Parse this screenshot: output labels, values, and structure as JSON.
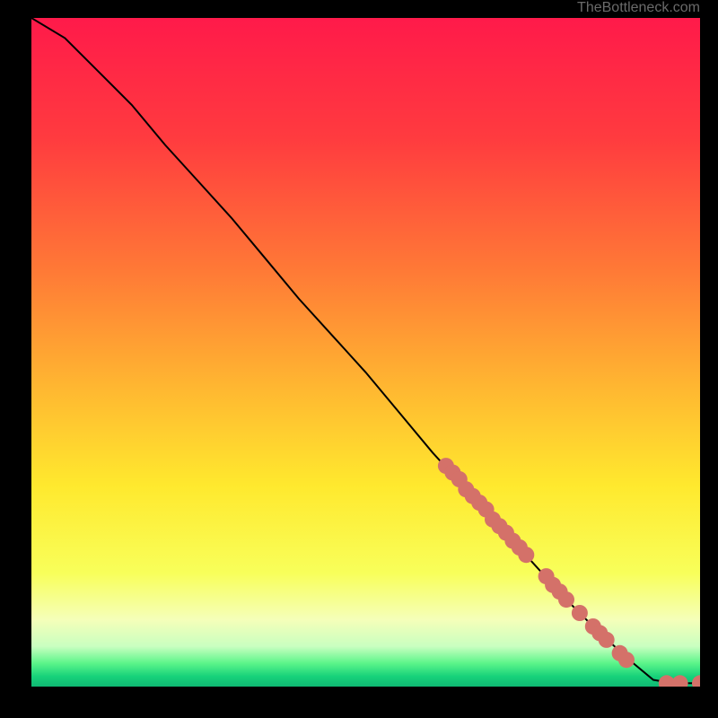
{
  "attribution": "TheBottleneck.com",
  "chart_data": {
    "type": "line",
    "title": "",
    "xlabel": "",
    "ylabel": "",
    "xlim": [
      0,
      100
    ],
    "ylim": [
      0,
      100
    ],
    "curve": [
      {
        "x": 0,
        "y": 100
      },
      {
        "x": 5,
        "y": 97
      },
      {
        "x": 10,
        "y": 92
      },
      {
        "x": 15,
        "y": 87
      },
      {
        "x": 20,
        "y": 81
      },
      {
        "x": 25,
        "y": 75.5
      },
      {
        "x": 30,
        "y": 70
      },
      {
        "x": 35,
        "y": 64
      },
      {
        "x": 40,
        "y": 58
      },
      {
        "x": 45,
        "y": 52.5
      },
      {
        "x": 50,
        "y": 47
      },
      {
        "x": 55,
        "y": 41
      },
      {
        "x": 60,
        "y": 35
      },
      {
        "x": 65,
        "y": 29.5
      },
      {
        "x": 70,
        "y": 24
      },
      {
        "x": 75,
        "y": 18.5
      },
      {
        "x": 80,
        "y": 13
      },
      {
        "x": 85,
        "y": 8
      },
      {
        "x": 90,
        "y": 3.5
      },
      {
        "x": 93,
        "y": 1
      },
      {
        "x": 96,
        "y": 0.5
      },
      {
        "x": 100,
        "y": 0.5
      }
    ],
    "series": [
      {
        "name": "points",
        "color": "#d47169",
        "values": [
          {
            "x": 62,
            "y": 33
          },
          {
            "x": 63,
            "y": 32
          },
          {
            "x": 64,
            "y": 31
          },
          {
            "x": 65,
            "y": 29.5
          },
          {
            "x": 66,
            "y": 28.5
          },
          {
            "x": 67,
            "y": 27.5
          },
          {
            "x": 68,
            "y": 26.5
          },
          {
            "x": 69,
            "y": 25
          },
          {
            "x": 70,
            "y": 24
          },
          {
            "x": 71,
            "y": 23
          },
          {
            "x": 72,
            "y": 21.8
          },
          {
            "x": 73,
            "y": 20.8
          },
          {
            "x": 74,
            "y": 19.7
          },
          {
            "x": 77,
            "y": 16.5
          },
          {
            "x": 78,
            "y": 15.2
          },
          {
            "x": 79,
            "y": 14.2
          },
          {
            "x": 80,
            "y": 13
          },
          {
            "x": 82,
            "y": 11
          },
          {
            "x": 84,
            "y": 9
          },
          {
            "x": 85,
            "y": 8
          },
          {
            "x": 86,
            "y": 7
          },
          {
            "x": 88,
            "y": 5
          },
          {
            "x": 89,
            "y": 4
          },
          {
            "x": 95,
            "y": 0.5
          },
          {
            "x": 97,
            "y": 0.5
          },
          {
            "x": 100,
            "y": 0.5
          }
        ]
      }
    ],
    "gradient_stops": [
      {
        "offset": 0,
        "color": "#ff1a4a"
      },
      {
        "offset": 0.18,
        "color": "#ff3b3f"
      },
      {
        "offset": 0.38,
        "color": "#ff7a36"
      },
      {
        "offset": 0.55,
        "color": "#ffb631"
      },
      {
        "offset": 0.7,
        "color": "#ffe92e"
      },
      {
        "offset": 0.83,
        "color": "#f8ff5a"
      },
      {
        "offset": 0.9,
        "color": "#f5ffb9"
      },
      {
        "offset": 0.94,
        "color": "#c9ffc0"
      },
      {
        "offset": 0.965,
        "color": "#5cf58a"
      },
      {
        "offset": 0.985,
        "color": "#17d17a"
      },
      {
        "offset": 1,
        "color": "#0fb973"
      }
    ]
  }
}
